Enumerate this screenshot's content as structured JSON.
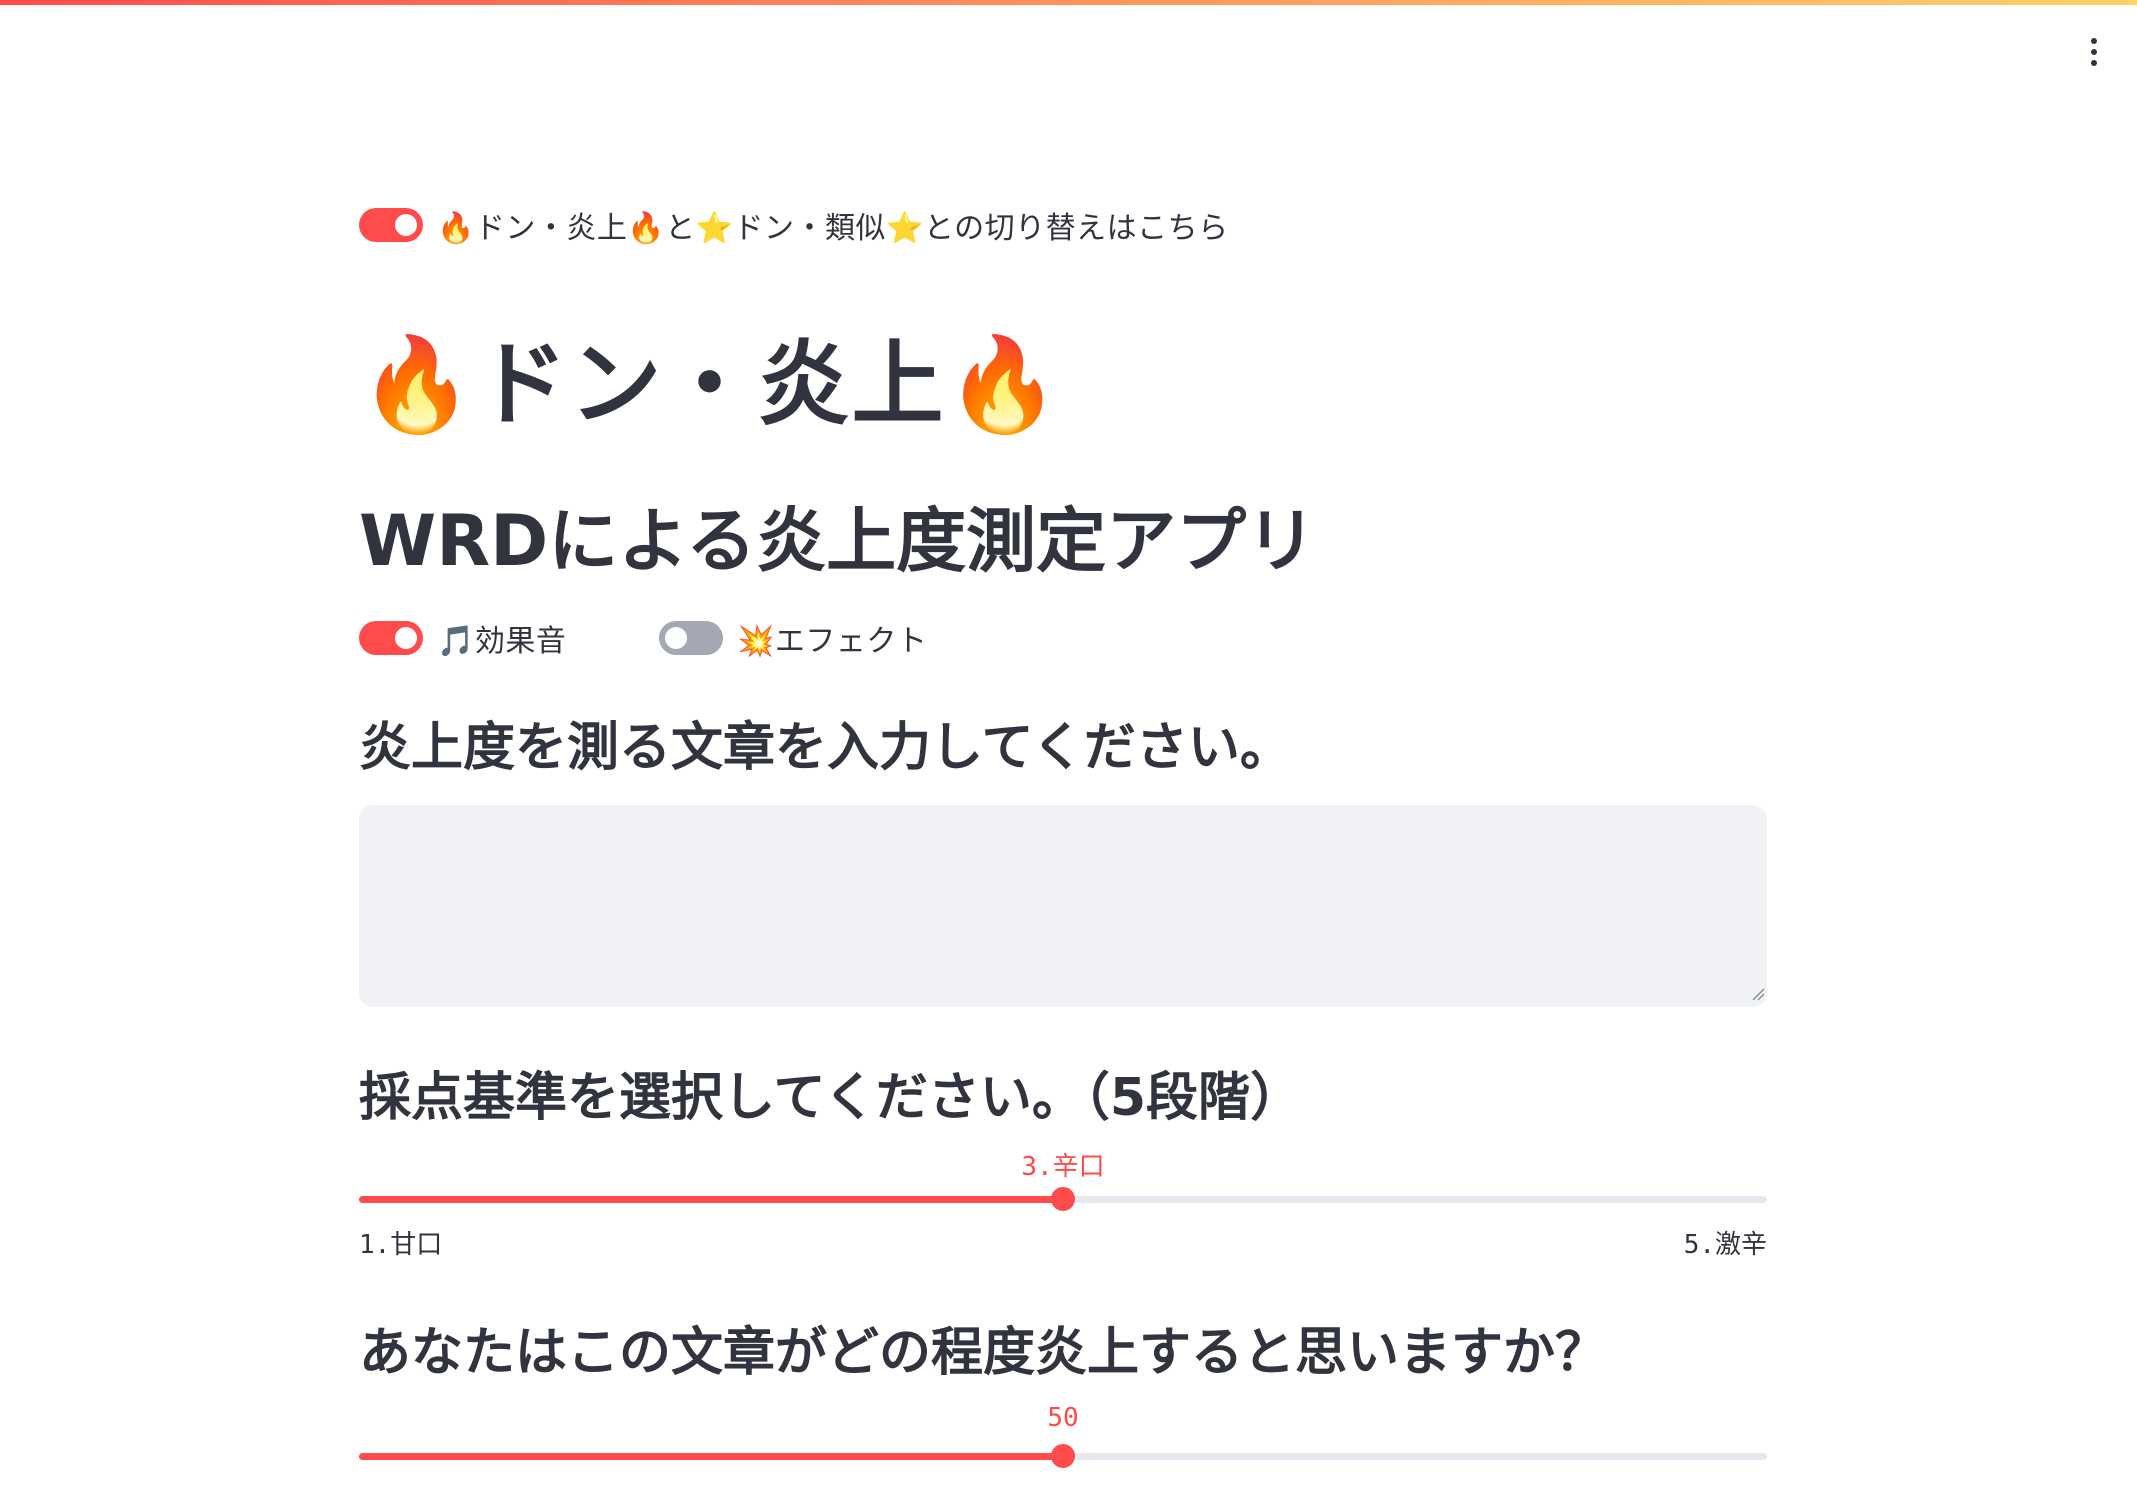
{
  "mode_toggle": {
    "label": "🔥ドン・炎上🔥と⭐ドン・類似⭐との切り替えはこちら",
    "on": true
  },
  "title": "🔥ドン・炎上🔥",
  "subtitle": "WRDによる炎上度測定アプリ",
  "sound_toggle": {
    "label": "🎵効果音",
    "on": true
  },
  "effect_toggle": {
    "label": "💥エフェクト",
    "on": false
  },
  "input_section": {
    "heading": "炎上度を測る文章を入力してください。",
    "value": "",
    "placeholder": ""
  },
  "criteria_section": {
    "heading": "採点基準を選択してください。（5段階）",
    "slider": {
      "value_label": "3.辛口",
      "value_fraction": 0.5,
      "min_label": "1.甘口",
      "max_label": "5.激辛"
    }
  },
  "prediction_section": {
    "heading": "あなたはこの文章がどの程度炎上すると思いますか？",
    "slider": {
      "value_label": "50",
      "value_fraction": 0.5
    }
  },
  "colors": {
    "accent": "#ff4b4b",
    "toggle_off": "#a3a8b4",
    "input_bg": "#f0f2f6",
    "text": "#31333f"
  },
  "icons": {
    "menu": "vertical-ellipsis-icon"
  }
}
